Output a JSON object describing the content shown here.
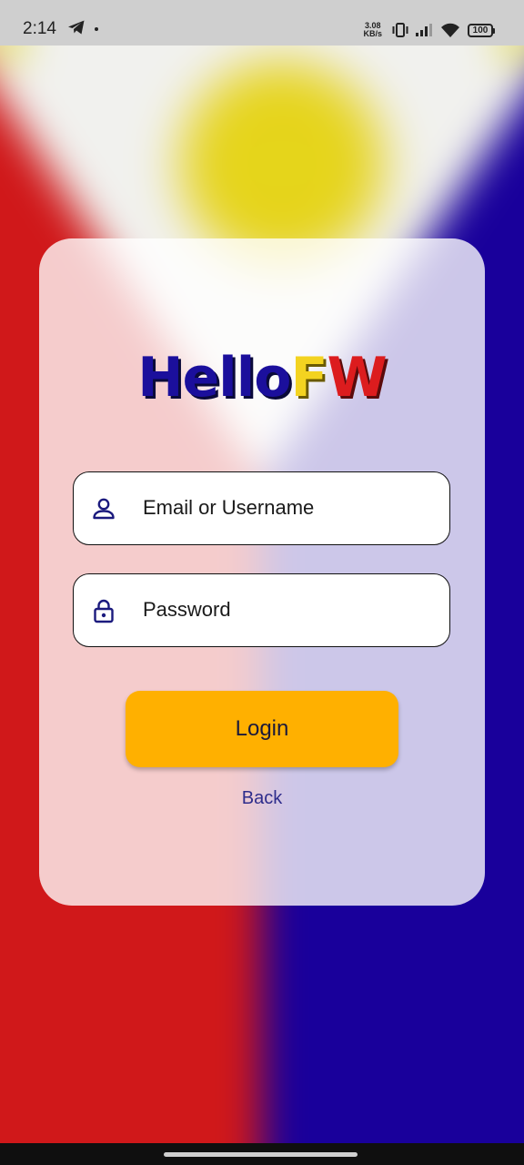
{
  "status_bar": {
    "time": "2:14",
    "net_speed_value": "3.08",
    "net_speed_unit": "KB/s",
    "battery": "100"
  },
  "logo": {
    "part1": "Hello",
    "part2": "F",
    "part3": "W"
  },
  "form": {
    "username_placeholder": "Email or Username",
    "username_icon": "person-icon",
    "password_placeholder": "Password",
    "password_icon": "lock-icon",
    "login_label": "Login",
    "back_label": "Back"
  },
  "colors": {
    "flag_red": "#d0181a",
    "flag_blue": "#19009b",
    "flag_white": "#f1f1ee",
    "flag_sun": "#e5d51a",
    "accent_button": "#ffb000",
    "link": "#2e2d8c"
  }
}
